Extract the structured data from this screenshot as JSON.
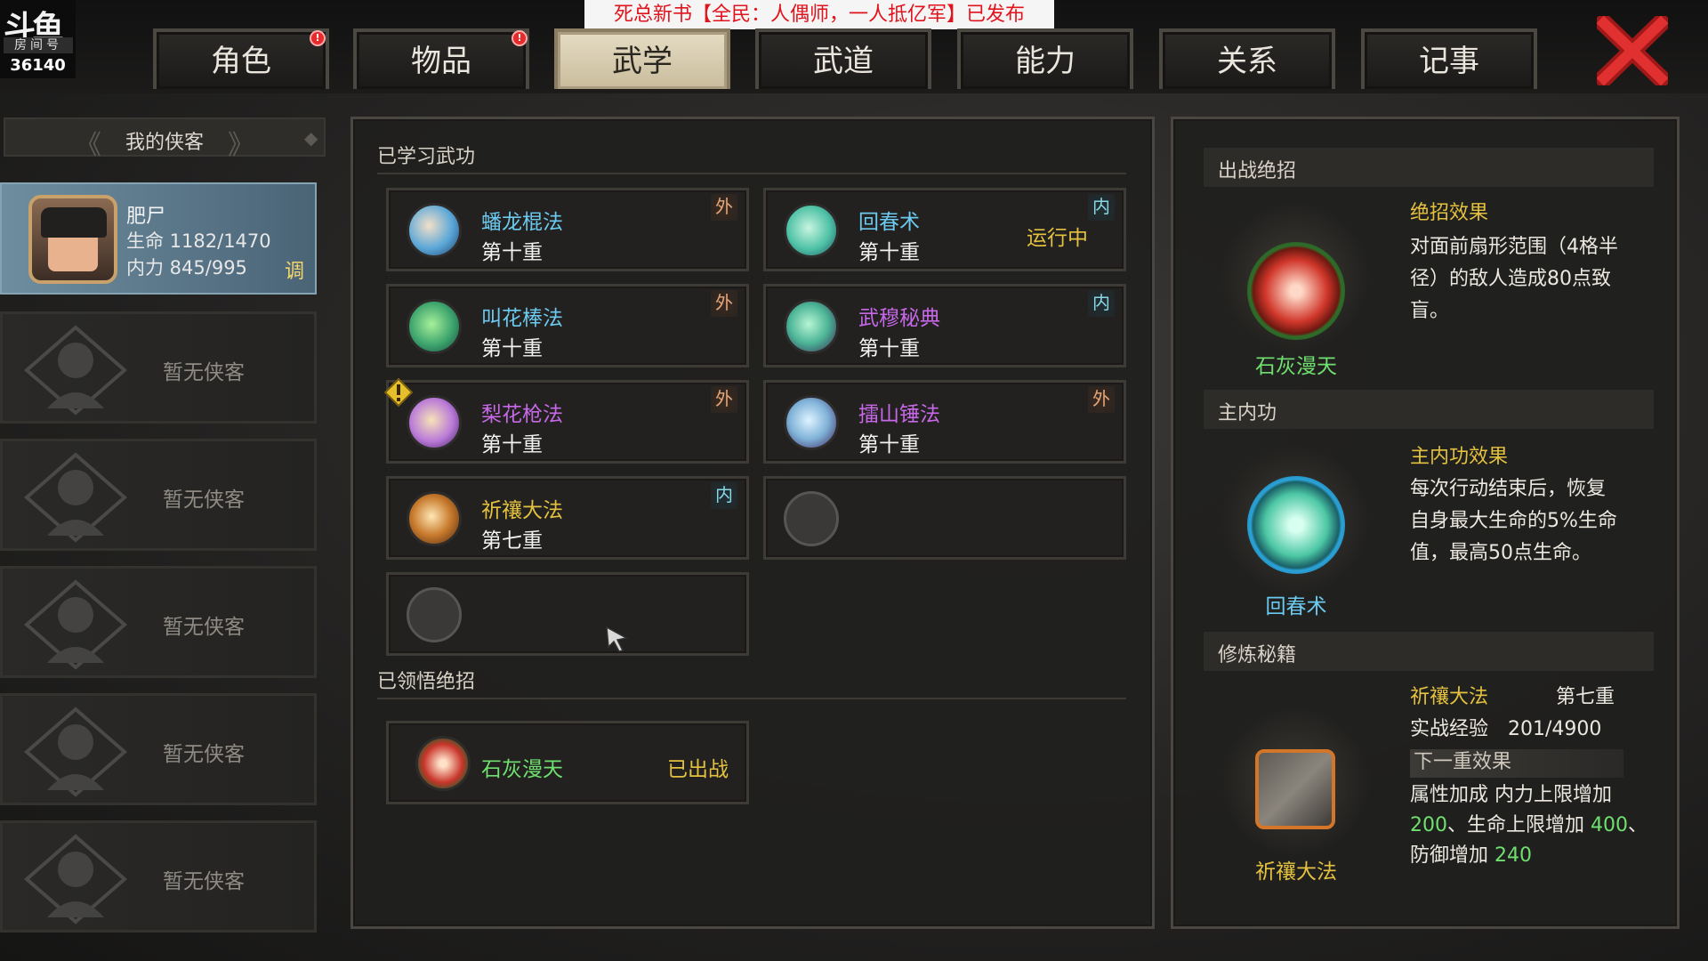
{
  "logo": {
    "glyph": "斗鱼",
    "room_label": "房间号",
    "room_id": "36140"
  },
  "banner": {
    "text": "死总新书【全民：人偶师，一人抵亿军】已发布"
  },
  "tabs": [
    {
      "label": "角色",
      "badge": "!"
    },
    {
      "label": "物品",
      "badge": "!"
    },
    {
      "label": "武学"
    },
    {
      "label": "武道"
    },
    {
      "label": "能力"
    },
    {
      "label": "关系"
    },
    {
      "label": "记事"
    }
  ],
  "left": {
    "header": "我的侠客",
    "character": {
      "name": "肥尸",
      "hp": "生命 1182/1470",
      "mp": "内力 845/995",
      "tag": "调"
    },
    "empty_label": "暂无侠客"
  },
  "middle": {
    "learned_title": "已学习武功",
    "skills": [
      {
        "name": "蟠龙棍法",
        "level": "第十重",
        "type": "外",
        "color": "#6cc9ef"
      },
      {
        "name": "回春术",
        "level": "第十重",
        "type": "内",
        "status": "运行中",
        "color": "#6cc9ef"
      },
      {
        "name": "叫花棒法",
        "level": "第十重",
        "type": "外",
        "color": "#6cc9ef"
      },
      {
        "name": "武穆秘典",
        "level": "第十重",
        "type": "内",
        "color": "#c768e8"
      },
      {
        "name": "梨花枪法",
        "level": "第十重",
        "type": "外",
        "color": "#c768e8"
      },
      {
        "name": "擂山锤法",
        "level": "第十重",
        "type": "外",
        "color": "#c768e8"
      },
      {
        "name": "祈禳大法",
        "level": "第七重",
        "type": "内",
        "color": "#e4c13f"
      }
    ],
    "ultimate_title": "已领悟绝招",
    "ultimate": {
      "name": "石灰漫天",
      "status": "已出战"
    }
  },
  "right": {
    "battle_head": "出战绝招",
    "ult_effect_title": "绝招效果",
    "ult_effect_lines": [
      "对面前扇形范围（4格半",
      "径）的敌人造成80点致",
      "盲。"
    ],
    "ult_name": "石灰漫天",
    "main_head": "主内功",
    "main_effect_title": "主内功效果",
    "main_effect_lines": [
      "每次行动结束后，恢复",
      "自身最大生命的5%生命",
      "值，最高50点生命。"
    ],
    "main_name": "回春术",
    "train_head": "修炼秘籍",
    "train_name": "祈禳大法",
    "train_level": "第七重",
    "exp_label": "实战经验",
    "exp_value": "201/4900",
    "next_label": "下一重效果",
    "bonus_line1": "属性加成  内力上限增加",
    "bonus_v1": "200",
    "bonus_mid": "、生命上限增加 ",
    "bonus_v2": "400",
    "bonus_tail": "、",
    "bonus_line3": "防御增加 ",
    "bonus_v3": "240",
    "book_name": "祈禳大法"
  }
}
